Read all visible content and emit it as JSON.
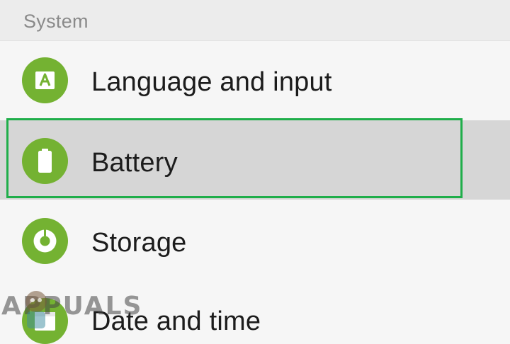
{
  "section": {
    "title": "System"
  },
  "items": [
    {
      "label": "Language and input",
      "icon": "language-input-icon"
    },
    {
      "label": "Battery",
      "icon": "battery-icon",
      "highlighted": true
    },
    {
      "label": "Storage",
      "icon": "storage-icon"
    },
    {
      "label": "Date and time",
      "icon": "date-time-icon"
    }
  ],
  "watermark": {
    "text": "APPUALS"
  },
  "colors": {
    "icon_green": "#74b232",
    "highlight_border": "#1fae4a",
    "selected_row": "#d6d6d6",
    "header_bg": "#ececec",
    "page_bg": "#f6f6f6"
  }
}
